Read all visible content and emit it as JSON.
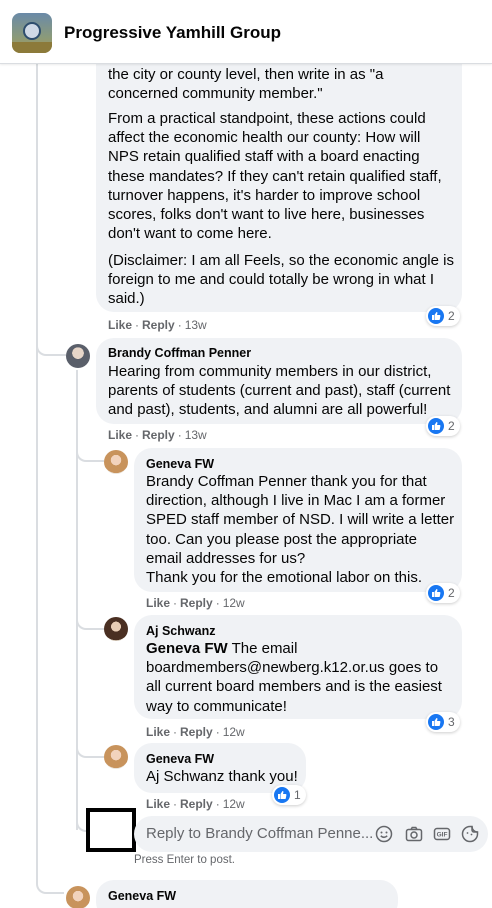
{
  "header": {
    "group_name": "Progressive Yamhill Group"
  },
  "comment_top": {
    "lines_p1": [
      "the city or county level, then write in as \"a",
      "concerned community member.\""
    ],
    "lines_p2": [
      "From a practical standpoint, these actions could",
      "affect the economic health our county: How will",
      "NPS retain qualified staff with a board enacting",
      "these mandates? If they can't retain qualified staff,",
      "turnover happens, it's harder to improve school",
      "scores, folks don't want to live here, businesses",
      "don't want to come here."
    ],
    "lines_p3": [
      "(Disclaimer: I am all Feels, so the economic angle is",
      "foreign to me and could totally be wrong in what I",
      "said.)"
    ],
    "like": "Like",
    "reply": "Reply",
    "time": "13w",
    "reactions": "2"
  },
  "comment_brandy": {
    "author": "Brandy Coffman Penner",
    "lines": [
      "Hearing from community members in our district,",
      "parents of students (current and past), staff (current",
      "and past), students, and alumni are all powerful!"
    ],
    "like": "Like",
    "reply": "Reply",
    "time": "13w",
    "reactions": "2"
  },
  "reply_geneva_1": {
    "author": "Geneva FW",
    "lines": [
      "Brandy Coffman Penner thank you for that",
      "direction, although I live in Mac I am a former",
      "SPED staff member of NSD. I will write a letter",
      "too. Can you please post the appropriate",
      "email addresses for us?",
      "Thank you for the emotional labor on this."
    ],
    "like": "Like",
    "reply": "Reply",
    "time": "12w",
    "reactions": "2"
  },
  "reply_aj": {
    "author": "Aj Schwanz",
    "mention": "Geneva FW",
    "line1_rest": " The email",
    "lines": [
      "boardmembers@newberg.k12.or.us goes to",
      "all current board members and is the easiest",
      "way to communicate!"
    ],
    "like": "Like",
    "reply": "Reply",
    "time": "12w",
    "reactions": "3"
  },
  "reply_geneva_2": {
    "author": "Geneva FW",
    "text": "Aj Schwanz thank you!",
    "like": "Like",
    "reply": "Reply",
    "time": "12w",
    "reactions": "1"
  },
  "reply_composer": {
    "placeholder": "Reply to Brandy Coffman Penne...",
    "hint": "Press Enter to post.",
    "icons": [
      "emoji-icon",
      "camera-icon",
      "gif-icon",
      "sticker-icon"
    ]
  },
  "comment_next": {
    "author": "Geneva FW"
  },
  "colors": {
    "like_blue": "#1877f2",
    "bubble": "#f0f2f5",
    "meta_gray": "#65676b"
  }
}
